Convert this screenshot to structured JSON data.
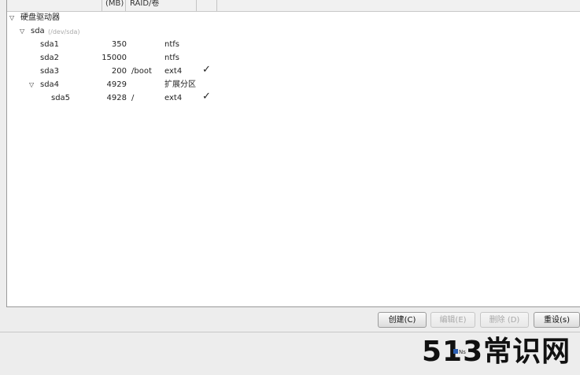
{
  "columns": {
    "size_tail": "(MB)",
    "raid_tail": "RAID/卷"
  },
  "tree": {
    "root_label": "硬盘驱动器",
    "disk": {
      "name": "sda",
      "path": "(/dev/sda)"
    },
    "partitions": [
      {
        "name": "sda1",
        "size": "350",
        "mount": "",
        "type": "ntfs",
        "format_checked": false
      },
      {
        "name": "sda2",
        "size": "15000",
        "mount": "",
        "type": "ntfs",
        "format_checked": false
      },
      {
        "name": "sda3",
        "size": "200",
        "mount": "/boot",
        "type": "ext4",
        "format_checked": true
      },
      {
        "name": "sda4",
        "size": "4929",
        "mount": "",
        "type": "扩展分区",
        "format_checked": false
      },
      {
        "name": "sda5",
        "size": "4928",
        "mount": "/",
        "type": "ext4",
        "format_checked": true
      }
    ],
    "check_glyph": "✓"
  },
  "buttons": {
    "create": "创建(C)",
    "edit": "编辑(E)",
    "delete": "删除 (D)",
    "reset": "重设(s)"
  },
  "watermark": {
    "text": "513常识网",
    "mini_text": "Ns"
  }
}
